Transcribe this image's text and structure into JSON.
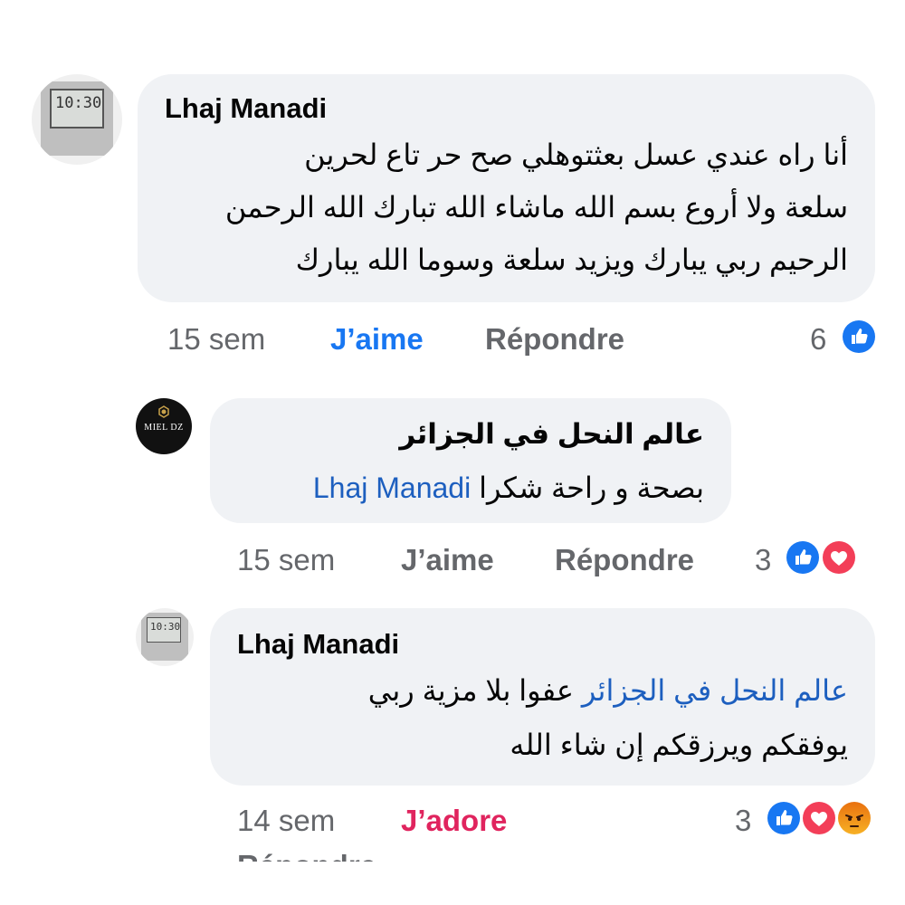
{
  "comments": [
    {
      "author": "Lhaj Manadi",
      "avatar": "clock-avatar",
      "avatar_text": "10:30",
      "lines": [
        "أنا راه عندي عسل بعثتوهلي صح حر تاع لحرين",
        "سلعة ولا أروع بسم الله ماشاء الله تبارك الله الرحمن",
        "الرحيم ربي يبارك ويزيد سلعة وسوما الله يبارك"
      ],
      "time": "15 sem",
      "like_label": "J’aime",
      "reply_label": "Répondre",
      "reaction_count": "6",
      "reactions": [
        "like-icon"
      ]
    },
    {
      "author": "عالم النحل في الجزائر",
      "avatar": "mieldz-logo-avatar",
      "avatar_text": "MIEL DZ",
      "text": "بصحة و راحة شكرا",
      "mention": "Lhaj Manadi",
      "time": "15 sem",
      "like_label": "J’aime",
      "reply_label": "Répondre",
      "reaction_count": "3",
      "reactions": [
        "like-icon",
        "love-icon"
      ]
    },
    {
      "author": "Lhaj Manadi",
      "avatar": "clock-avatar",
      "avatar_text": "10:30",
      "mention": "عالم النحل في الجزائر",
      "line1_text": "عفوا بلا مزية ربي",
      "line2": "يوفقكم ويرزقكم إن شاء الله",
      "time": "14 sem",
      "like_label": "J’adore",
      "reply_label": "Répondre",
      "reaction_count": "3",
      "reactions": [
        "like-icon",
        "love-icon",
        "angry-icon"
      ]
    }
  ],
  "colors": {
    "bubble": "#f0f2f5",
    "like": "#1877f2",
    "love": "#f33e58",
    "angry": "#e9710f",
    "mention": "#1d5fbf",
    "meta": "#65676b"
  }
}
